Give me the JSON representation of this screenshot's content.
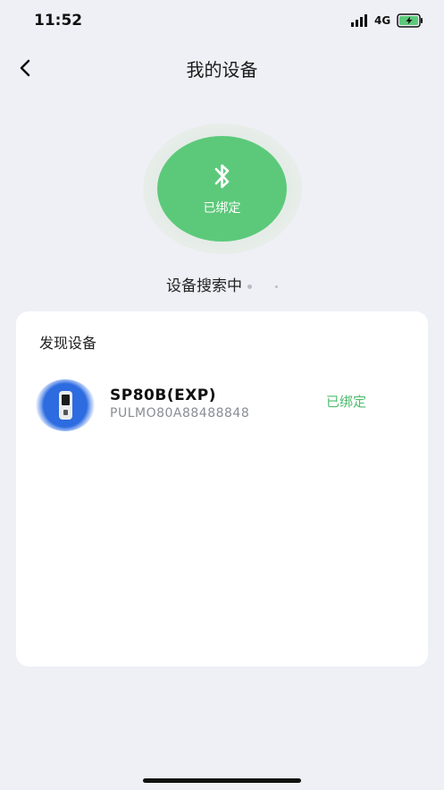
{
  "status_bar": {
    "time": "11:52",
    "network": "4G",
    "icons": [
      "signal-icon",
      "battery-charging-icon"
    ]
  },
  "nav": {
    "title": "我的设备",
    "back_icon": "chevron-left-icon"
  },
  "bluetooth": {
    "icon": "bluetooth-icon",
    "status": "已绑定",
    "color": "#5cc97a"
  },
  "search": {
    "status": "设备搜索中"
  },
  "discovered": {
    "title": "发现设备",
    "devices": [
      {
        "name": "SP80B(EXP)",
        "id": "PULMO80A88488848",
        "status": "已绑定",
        "status_color": "#4fbb6d",
        "icon": "oximeter-device-icon"
      }
    ]
  }
}
